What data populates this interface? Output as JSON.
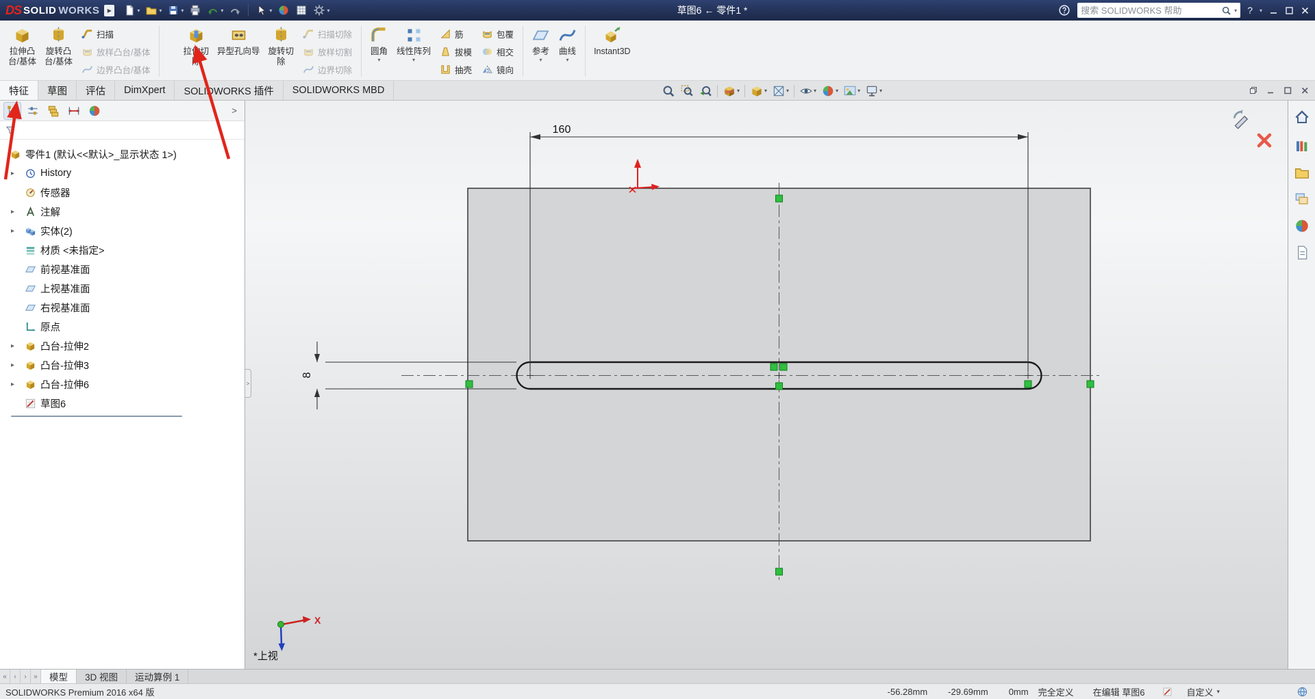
{
  "icons": {
    "dropdown": "▾",
    "expander": "▸",
    "flyout": "▶",
    "chevron_right": ">",
    "vcr_first": "«",
    "vcr_prev": "‹",
    "vcr_next": "›",
    "vcr_last": "»"
  },
  "titlebar": {
    "logo_ds": "DS",
    "logo_solid": "SOLID",
    "logo_works": "WORKS",
    "doc_title": "草图6 ← 零件1 *",
    "search_placeholder": "搜索 SOLIDWORKS 帮助",
    "help": "?"
  },
  "ribbon": {
    "extrude_boss_1": "拉伸凸",
    "extrude_boss_2": "台/基体",
    "revolve_boss_1": "旋转凸",
    "revolve_boss_2": "台/基体",
    "sweep": "扫描",
    "loft": "放样凸台/基体",
    "boundary": "边界凸台/基体",
    "extrude_cut_1": "拉伸切",
    "extrude_cut_2": "除",
    "hole_wizard": "异型孔向导",
    "revolve_cut_1": "旋转切",
    "revolve_cut_2": "除",
    "sweep_cut": "扫描切除",
    "loft_cut": "放样切割",
    "boundary_cut": "边界切除",
    "fillet": "圆角",
    "linear_pattern": "线性阵列",
    "rib": "筋",
    "draft": "拔模",
    "shell": "抽壳",
    "wrap": "包覆",
    "intersect": "相交",
    "mirror": "镜向",
    "reference": "参考",
    "curves": "曲线",
    "instant3d": "Instant3D"
  },
  "tabs": [
    "特征",
    "草图",
    "评估",
    "DimXpert",
    "SOLIDWORKS 插件",
    "SOLIDWORKS MBD"
  ],
  "tree": {
    "root": "零件1 (默认<<默认>_显示状态 1>)",
    "items": [
      {
        "label": "History"
      },
      {
        "label": "传感器"
      },
      {
        "label": "注解"
      },
      {
        "label": "实体(2)"
      },
      {
        "label": "材质 <未指定>"
      },
      {
        "label": "前视基准面"
      },
      {
        "label": "上视基准面"
      },
      {
        "label": "右视基准面"
      },
      {
        "label": "原点"
      },
      {
        "label": "凸台-拉伸2"
      },
      {
        "label": "凸台-拉伸3"
      },
      {
        "label": "凸台-拉伸6"
      },
      {
        "label": "草图6"
      }
    ]
  },
  "viewport": {
    "dim_length": "160",
    "dim_width": "8",
    "view_label": "*上视",
    "triad_x": "X"
  },
  "bottom_tabs": [
    "模型",
    "3D 视图",
    "运动算例 1"
  ],
  "status": {
    "product": "SOLIDWORKS Premium 2016 x64 版",
    "coord_x": "-56.28mm",
    "coord_y": "-29.69mm",
    "coord_z": "0mm",
    "definition": "完全定义",
    "editing": "在编辑 草图6",
    "custom": "自定义"
  }
}
